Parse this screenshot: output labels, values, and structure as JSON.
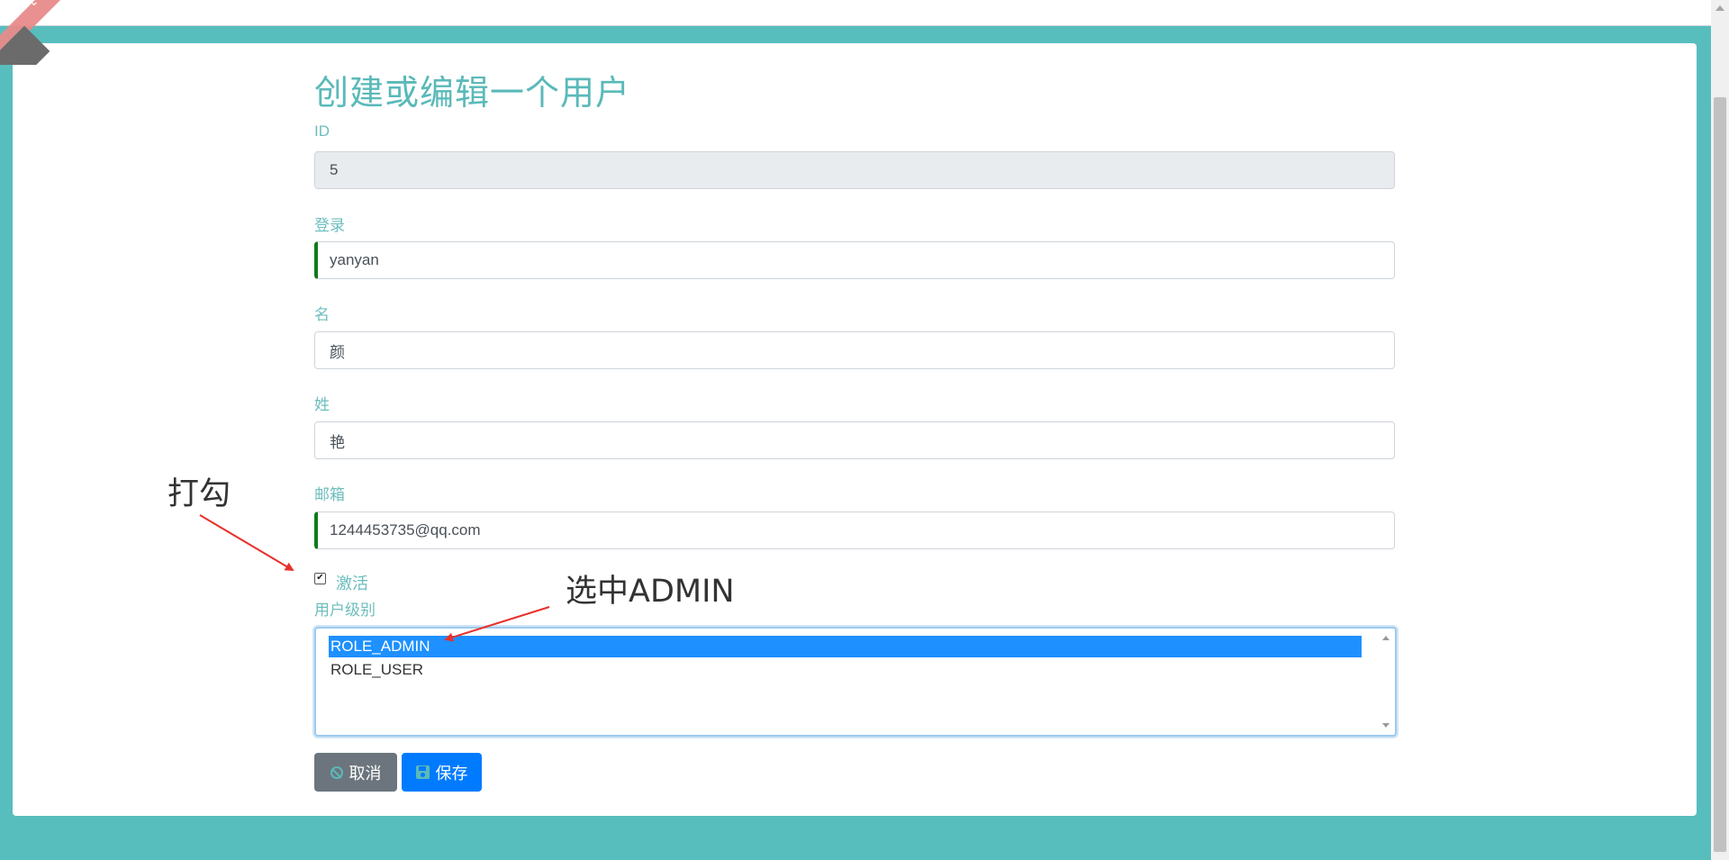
{
  "form": {
    "title": "创建或编辑一个用户",
    "fields": {
      "id": {
        "label": "ID",
        "value": "5"
      },
      "login": {
        "label": "登录",
        "value": "yanyan"
      },
      "first_name": {
        "label": "名",
        "value": "颜"
      },
      "last_name": {
        "label": "姓",
        "value": "艳"
      },
      "email": {
        "label": "邮箱",
        "value": "1244453735@qq.com"
      }
    },
    "activated": {
      "label": "激活",
      "checked": true
    },
    "authorities": {
      "label": "用户级别",
      "options": [
        "ROLE_ADMIN",
        "ROLE_USER"
      ],
      "selected": "ROLE_ADMIN"
    },
    "buttons": {
      "cancel": "取消",
      "save": "保存"
    }
  },
  "annotations": {
    "check": "打勾",
    "select_admin": "选中ADMIN",
    "arrow_color": "#e8312b"
  },
  "icons": {
    "cancel": "ban-icon",
    "save": "floppy-icon",
    "corner": "chevron-down-icon"
  },
  "colors": {
    "background": "#58bdbd",
    "label": "#6dbdbd",
    "valid_border": "#0f7a1c",
    "selected_option": "#1e90ff",
    "cancel_button": "#6c757d",
    "save_button": "#007bff"
  }
}
